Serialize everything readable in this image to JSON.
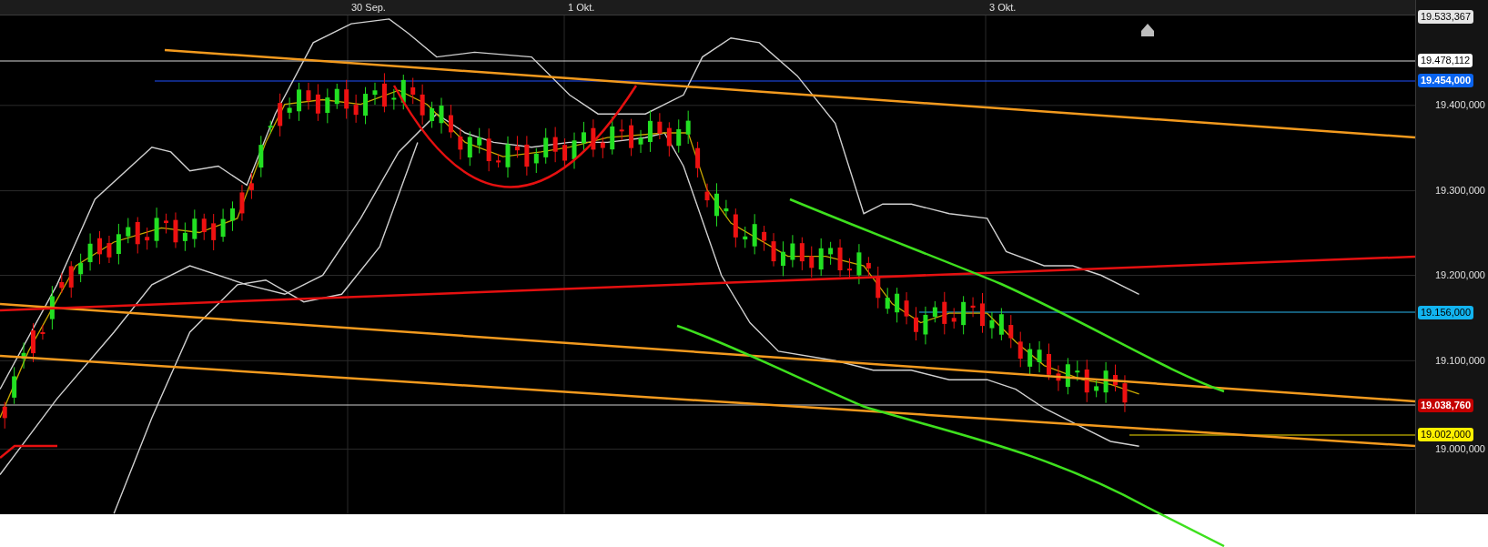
{
  "time_axis": {
    "labels": [
      "30 Sep.",
      "1 Okt.",
      "3 Okt."
    ]
  },
  "price_axis": {
    "labels": [
      {
        "text": "19.533,367",
        "kind": "marker",
        "color": "#e6e6e6"
      },
      {
        "text": "19.478,112",
        "kind": "marker",
        "color": "#ffffff"
      },
      {
        "text": "19.454,000",
        "kind": "marker",
        "color": "#0a64f0"
      },
      {
        "text": "19.400,000",
        "kind": "tick"
      },
      {
        "text": "19.300,000",
        "kind": "tick"
      },
      {
        "text": "19.200,000",
        "kind": "tick"
      },
      {
        "text": "19.156,000",
        "kind": "marker",
        "color": "#12b4f0"
      },
      {
        "text": "19.100,000",
        "kind": "tick"
      },
      {
        "text": "19.038,760",
        "kind": "marker",
        "color": "#c40000"
      },
      {
        "text": "19.002,000",
        "kind": "marker",
        "color": "#fff000"
      },
      {
        "text": "19.000,000",
        "kind": "tick"
      }
    ]
  }
}
